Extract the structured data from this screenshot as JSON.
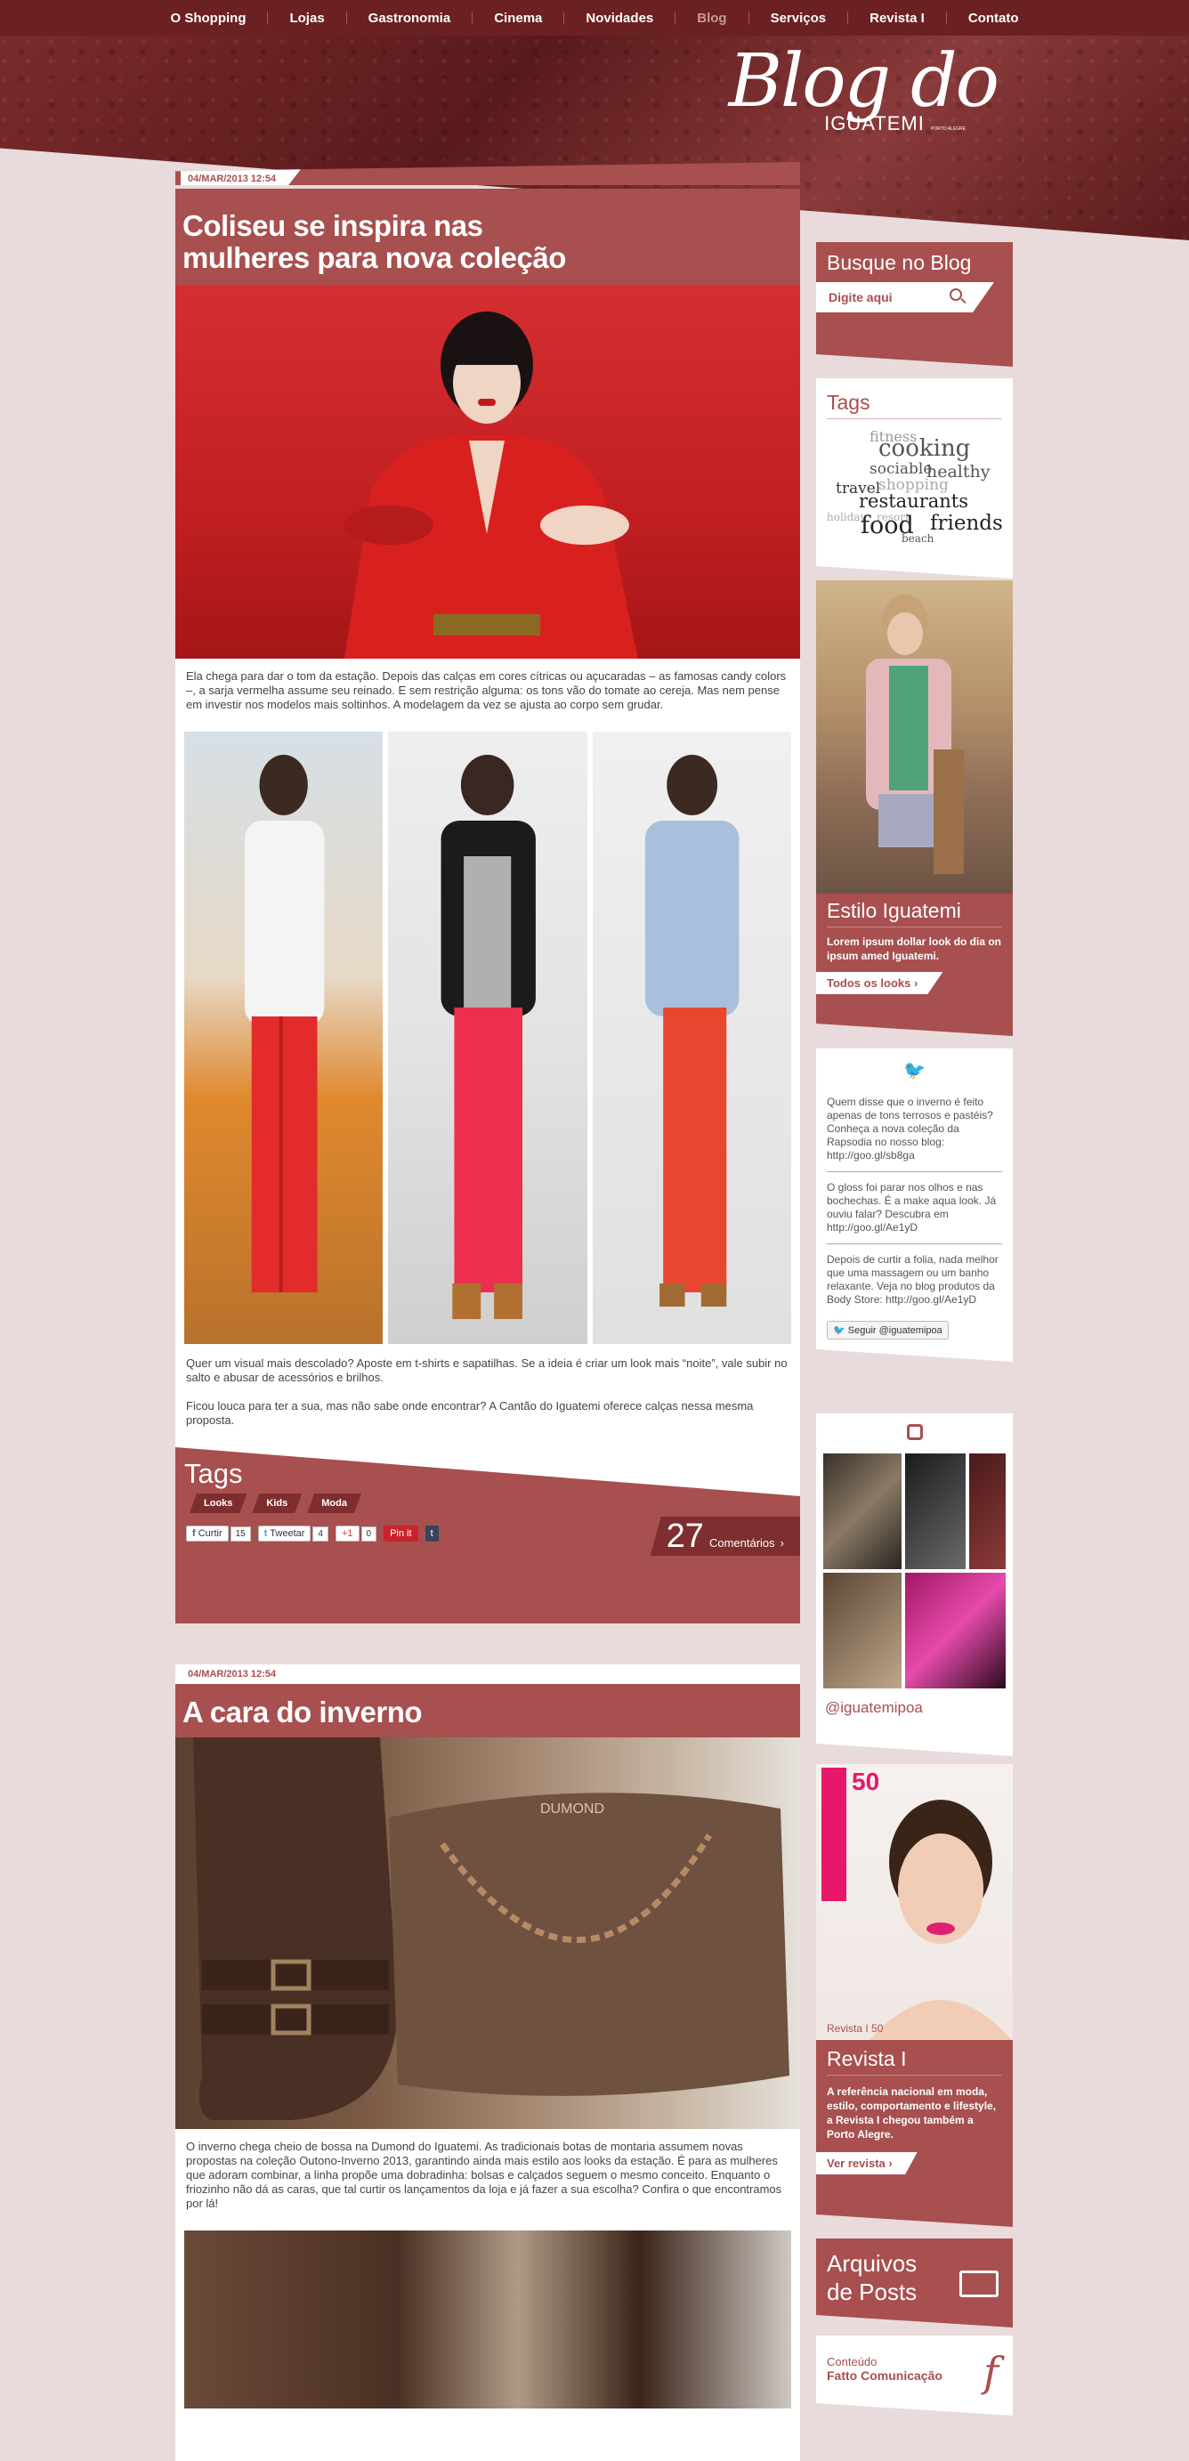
{
  "nav": {
    "items": [
      "O Shopping",
      "Lojas",
      "Gastronomia",
      "Cinema",
      "Novidades",
      "Blog",
      "Serviços",
      "Revista I",
      "Contato"
    ],
    "active": "Blog"
  },
  "logo": {
    "script": "Blog do",
    "brand": "IGUATEMI",
    "small": "PORTO ALEGRE"
  },
  "posts": [
    {
      "date": "04/MAR/2013 12:54",
      "title": "Coliseu se inspira nas mulheres para nova coleção",
      "p1": "Ela chega para dar o tom da estação. Depois das calças em cores cítricas ou açucaradas – as famosas candy colors –, a sarja vermelha assume seu reinado. E sem restrição alguma: os tons vão do tomate ao cereja. Mas nem pense em investir nos modelos mais soltinhos. A modelagem da vez se ajusta ao corpo sem grudar.",
      "p2": "Quer um visual mais descolado? Aposte em t-shirts e sapatilhas. Se a ideia é criar um look mais “noite”, vale subir no salto e abusar de acessórios e brilhos.",
      "p3": "Ficou louca para ter a sua, mas não sabe onde encontrar? A Cantão do Iguatemi oferece calças nessa mesma proposta.",
      "tags_title": "Tags",
      "tags": [
        "Looks",
        "Kids",
        "Moda"
      ],
      "share": {
        "curtir": "Curtir",
        "curtir_count": "15",
        "tweet": "Tweetar",
        "tweet_count": "4",
        "gplus": "+1",
        "gplus_count": "0",
        "pin": "Pin it",
        "tumblr": "t"
      },
      "comments_count": "27",
      "comments_label": "Comentários"
    },
    {
      "date": "04/MAR/2013 12:54",
      "title": "A cara do inverno",
      "img_label": "DUMOND",
      "p1": "O inverno chega cheio de bossa na Dumond do Iguatemi. As tradicionais botas de montaria assumem novas propostas na coleção Outono-Inverno 2013, garantindo ainda mais estilo aos looks da estação. É para as mulheres que adoram combinar, a linha propõe uma dobradinha: bolsas e calçados seguem o mesmo conceito. Enquanto o friozinho não dá as caras, que tal curtir os lançamentos da loja e já fazer a sua escolha? Confira o que encontramos por lá!"
    }
  ],
  "sidebar": {
    "search": {
      "title": "Busque no Blog",
      "placeholder": "Digite aqui"
    },
    "tags": {
      "title": "Tags",
      "cloud": [
        "fitness",
        "cooking",
        "sociable",
        "healthy",
        "travel",
        "shopping",
        "restaurants",
        "holiday",
        "resort",
        "food",
        "friends",
        "beach"
      ]
    },
    "estilo": {
      "title": "Estilo Iguatemi",
      "text": "Lorem ipsum dollar look do dia on ipsum amed Iguatemi.",
      "button": "Todos os looks"
    },
    "twitter": {
      "tweets": [
        "Quem disse que o inverno é feito apenas de tons terrosos e pastéis? Conheça a nova coleção da Rapsodia no nosso blog: http://goo.gl/sb8ga",
        "O gloss foi parar nos olhos e nas bochechas. É a make aqua look. Já ouviu falar? Descubra em http://goo.gl/Ae1yD",
        "Depois de curtir a folia, nada melhor que uma massagem ou um banho relaxante. Veja no blog produtos da Body Store: http://goo.gl/Ae1yD"
      ],
      "follow": "Seguir @iguatemipoa"
    },
    "instagram": {
      "handle": "@iguatemipoa"
    },
    "revista": {
      "cover_label": "Revista I 50",
      "cover_number": "50",
      "title": "Revista I",
      "text": "A referência nacional em moda, estilo, comportamento e lifestyle, a Revista I chegou também a Porto Alegre.",
      "button": "Ver revista"
    },
    "arquivos": {
      "title_line1": "Arquivos",
      "title_line2": "de Posts"
    },
    "credit": {
      "label": "Conteúdo",
      "company": "Fatto Comunicação",
      "logo": "f"
    }
  },
  "colors": {
    "accent": "#a84f4f",
    "dark": "#6b2022",
    "bg": "#e9dbdb"
  }
}
